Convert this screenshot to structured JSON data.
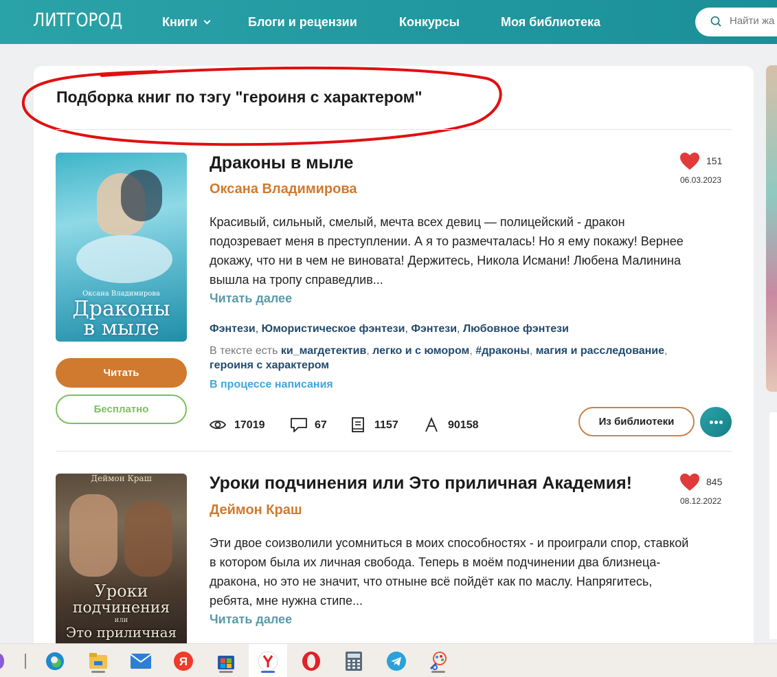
{
  "header": {
    "logo": "ЛИТГОРОД",
    "nav": [
      "Книги",
      "Блоги и рецензии",
      "Конкурсы",
      "Моя библиотека"
    ],
    "search_placeholder": "Найти жа"
  },
  "page_title": "Подборка книг по тэгу \"героиня с характером\"",
  "books": [
    {
      "title": "Драконы в мыле",
      "author": "Оксана Владимирова",
      "likes": "151",
      "date": "06.03.2023",
      "desc_lines": [
        "Красивый, сильный, смелый, мечта всех девиц — полицейский - дракон",
        "подозревает меня в преступлении. А я то размечталась! Но я ему покажу! Вернее",
        "докажу, что ни в чем не виновата! Держитесь, Никола Исмани! Любена Малинина",
        "вышла на тропу справедлив..."
      ],
      "read_more": "Читать далее",
      "genres": [
        "Фэнтези",
        "Юмористическое фэнтези",
        "Фэнтези",
        "Любовное фэнтези"
      ],
      "tags_prefix": "В тексте есть",
      "tags": [
        "ки_магдетектив",
        "легко и с юмором",
        "#драконы",
        "магия и расследование",
        "героиня с характером"
      ],
      "status": "В процессе написания",
      "views": "17019",
      "comments": "67",
      "pages": "1157",
      "chars": "90158",
      "read_button": "Читать",
      "free_button": "Бесплатно",
      "library_button": "Из библиотеки",
      "cover_author": "Оксана Владимирова",
      "cover_title": [
        "Драконы",
        "в мыле"
      ]
    },
    {
      "title": "Уроки подчинения или Это приличная Академия!",
      "author": "Деймон Краш",
      "likes": "845",
      "date": "08.12.2022",
      "desc_lines": [
        "Эти двое соизволили усомниться в моих способностях - и проиграли спор, ставкой",
        "в котором была их личная свобода. Теперь в моём подчинении два близнеца-",
        "дракона, но это не значит, что отныне всё пойдёт как по маслу. Напрягитесь,",
        "ребята, мне нужна стипе..."
      ],
      "read_more": "Читать далее",
      "cover_author": "Деймон Краш",
      "cover_title": [
        "Уроки",
        "подчинения",
        "или",
        "Это приличная"
      ]
    }
  ],
  "taskbar": [
    "edge-icon",
    "file-explorer-icon",
    "mail-icon",
    "yandex-icon",
    "store-icon",
    "yandex-browser-icon",
    "opera-icon",
    "calculator-icon",
    "telegram-icon",
    "paint-icon"
  ]
}
